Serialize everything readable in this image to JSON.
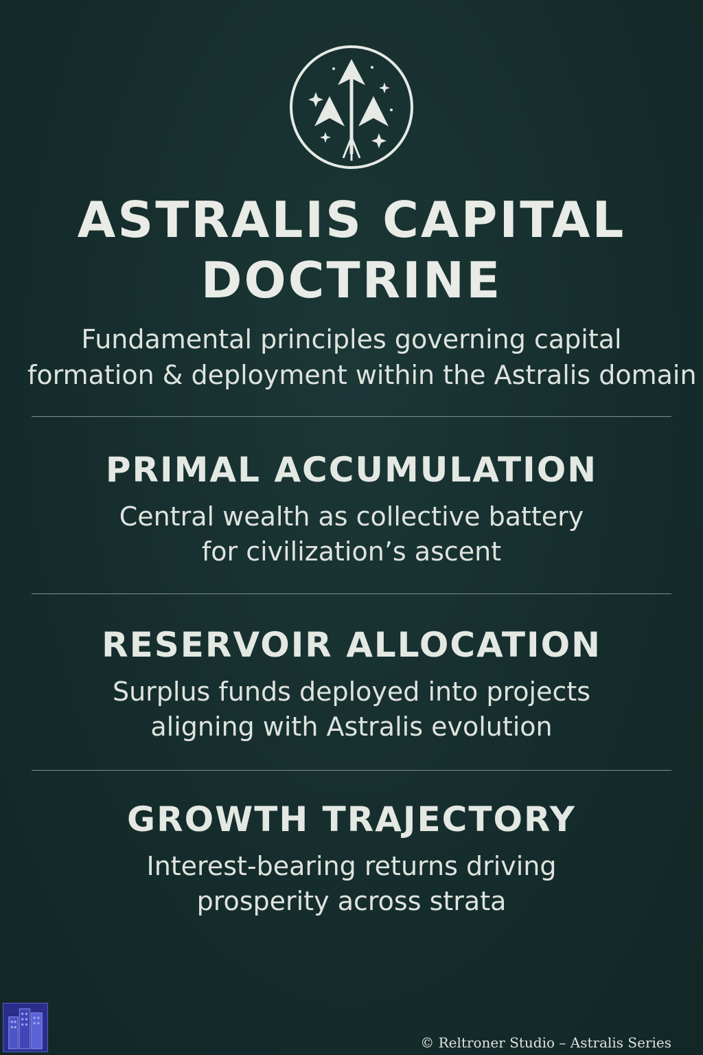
{
  "header": {
    "emblem_icon": "astralis-rocket-star-emblem",
    "title_line1": "ASTRALIS CAPITAL",
    "title_line2": "DOCTRINE",
    "subtitle_line1": "Fundamental principles governing capital",
    "subtitle_line2": "formation & deployment within the Astralis domain"
  },
  "sections": [
    {
      "heading": "PRIMAL ACCUMULATION",
      "line1": "Central wealth as collective battery",
      "line2": "for civilization’s ascent"
    },
    {
      "heading": "RESERVOIR ALLOCATION",
      "line1": "Surplus funds deployed into projects",
      "line2": "aligning with Astralis evolution"
    },
    {
      "heading": "GROWTH TRAJECTORY",
      "line1": "Interest-bearing returns driving",
      "line2": "prosperity across strata"
    }
  ],
  "footer": {
    "badge_icon": "city-buildings-icon",
    "credit": "© Reltroner Studio – Astralis Series"
  },
  "colors": {
    "background": "#16302f",
    "text": "#e6e9e4",
    "divider": "#7f908c",
    "badge": "#2a2d8a"
  }
}
